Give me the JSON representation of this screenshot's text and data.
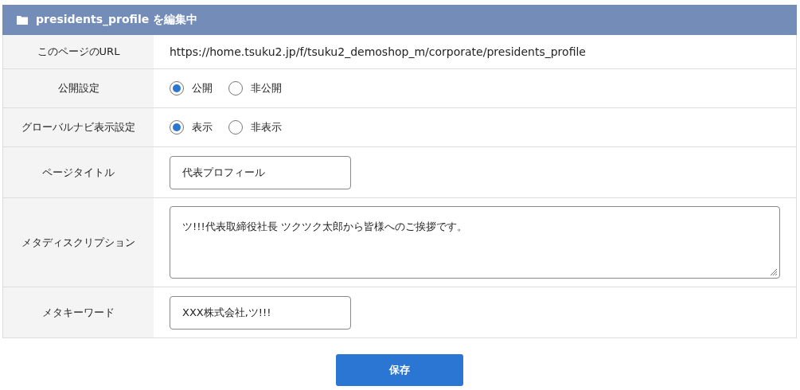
{
  "header": {
    "title": "presidents_profile を編集中"
  },
  "rows": [
    {
      "kind": "text",
      "label": "このページのURL",
      "value": "https://home.tsuku2.jp/f/tsuku2_demoshop_m/corporate/presidents_profile"
    },
    {
      "kind": "radio",
      "label": "公開設定",
      "options": [
        {
          "label": "公開",
          "selected": true
        },
        {
          "label": "非公開",
          "selected": false
        }
      ]
    },
    {
      "kind": "radio",
      "label": "グローバルナビ表示設定",
      "options": [
        {
          "label": "表示",
          "selected": true
        },
        {
          "label": "非表示",
          "selected": false
        }
      ]
    },
    {
      "kind": "input",
      "label": "ページタイトル",
      "value": "代表プロフィール"
    },
    {
      "kind": "textarea",
      "label": "メタディスクリプション",
      "value": "ツ!!!代表取締役社長 ツクツク太郎から皆様へのご挨拶です。"
    },
    {
      "kind": "input",
      "label": "メタキーワード",
      "value": "XXX株式会社,ツ!!!"
    }
  ],
  "save_button": "保存"
}
